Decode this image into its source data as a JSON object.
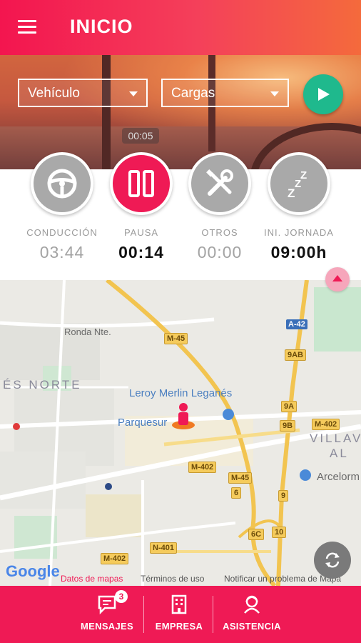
{
  "header": {
    "title": "INICIO"
  },
  "selectors": {
    "vehicle": "Vehículo",
    "loads": "Cargas"
  },
  "timer_badge": "00:05",
  "statuses": [
    {
      "label": "CONDUCCIÓN",
      "value": "03:44",
      "icon": "steering-wheel-icon"
    },
    {
      "label": "PAUSA",
      "value": "00:14",
      "icon": "pause-icon"
    },
    {
      "label": "OTROS",
      "value": "00:00",
      "icon": "tools-icon"
    },
    {
      "label": "INI. JORNADA",
      "value": "09:00h",
      "icon": "sleep-icon"
    }
  ],
  "map": {
    "labels": {
      "ronda": "Ronda Nte.",
      "district": "ÉS NORTE",
      "leroy": "Leroy Merlin Leganés",
      "parquesur": "Parquesur",
      "villa1": "VILLAV",
      "villa2": "AL",
      "arcelor": "Arcelorm"
    },
    "signs": {
      "m45a": "M-45",
      "a42": "A-42",
      "s9ab": "9AB",
      "s9a": "9A",
      "s9b": "9B",
      "m402a": "M-402",
      "m402b": "M-402",
      "m45b": "M-45",
      "s6": "6",
      "s9": "9",
      "s6c": "6C",
      "s10": "10",
      "n401": "N-401",
      "m402c": "M-402"
    },
    "google": "Google",
    "attribution": {
      "data": "Datos de mapas",
      "terms": "Términos de uso",
      "report": "Notificar un problema de Mapa"
    }
  },
  "bottom_nav": {
    "messages": "MENSAJES",
    "messages_count": "3",
    "company": "EMPRESA",
    "assistance": "ASISTENCIA"
  },
  "colors": {
    "accent": "#ef1a55",
    "play": "#1fb98d",
    "inactive": "#a9a9a9"
  }
}
